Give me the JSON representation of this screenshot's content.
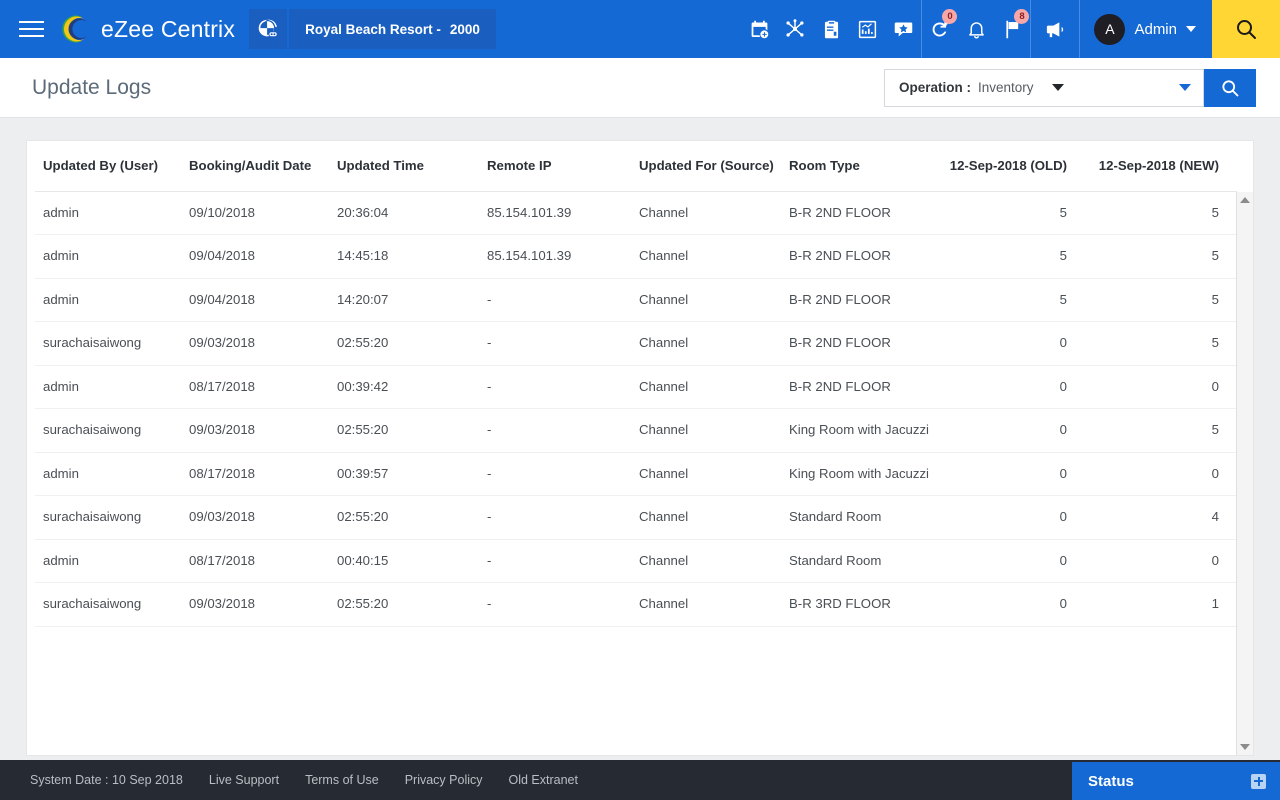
{
  "topbar": {
    "menu_icon": "hamburger-icon",
    "brand": "eZee Centrix",
    "property_name": "Royal Beach Resort -",
    "property_id": "2000",
    "tools": [
      {
        "icon": "calendar-add-icon",
        "name": "calendar"
      },
      {
        "icon": "channel-network-icon",
        "name": "channels"
      },
      {
        "icon": "clipboard-icon",
        "name": "reports"
      },
      {
        "icon": "chart-icon",
        "name": "analytics"
      },
      {
        "icon": "review-star-icon",
        "name": "reviews"
      }
    ],
    "alerts": [
      {
        "icon": "history-revert-icon",
        "badge": "0"
      },
      {
        "icon": "bell-icon",
        "badge": ""
      },
      {
        "icon": "flag-icon",
        "badge": "8"
      }
    ],
    "announce_icon": "megaphone-icon",
    "user_initial": "A",
    "user_name": "Admin",
    "search_icon": "search-icon",
    "colors": {
      "nav_blue": "#1569d4",
      "chip_blue": "#1a5fc0",
      "search_yellow": "#ffd633",
      "badge_pink": "#f7a7a7"
    }
  },
  "page": {
    "title": "Update Logs",
    "filter_label": "Operation :",
    "filter_value": "Inventory",
    "search_button_icon": "search-icon"
  },
  "table": {
    "columns": [
      {
        "label": "Updated By (User)",
        "align": "left"
      },
      {
        "label": "Booking/Audit Date",
        "align": "left"
      },
      {
        "label": "Updated Time",
        "align": "left"
      },
      {
        "label": "Remote IP",
        "align": "left"
      },
      {
        "label": "Updated For (Source)",
        "align": "left"
      },
      {
        "label": "Room Type",
        "align": "left"
      },
      {
        "label": "12-Sep-2018 (OLD)",
        "align": "right"
      },
      {
        "label": "12-Sep-2018 (NEW)",
        "align": "right"
      }
    ],
    "rows": [
      [
        "admin",
        "09/10/2018",
        "20:36:04",
        "85.154.101.39",
        "Channel",
        "B-R 2ND FLOOR",
        "5",
        "5"
      ],
      [
        "admin",
        "09/04/2018",
        "14:45:18",
        "85.154.101.39",
        "Channel",
        "B-R 2ND FLOOR",
        "5",
        "5"
      ],
      [
        "admin",
        "09/04/2018",
        "14:20:07",
        "-",
        "Channel",
        "B-R 2ND FLOOR",
        "5",
        "5"
      ],
      [
        "surachaisaiwong",
        "09/03/2018",
        "02:55:20",
        "-",
        "Channel",
        "B-R 2ND FLOOR",
        "0",
        "5"
      ],
      [
        "admin",
        "08/17/2018",
        "00:39:42",
        "-",
        "Channel",
        "B-R 2ND FLOOR",
        "0",
        "0"
      ],
      [
        "surachaisaiwong",
        "09/03/2018",
        "02:55:20",
        "-",
        "Channel",
        "King Room with Jacuzzi",
        "0",
        "5"
      ],
      [
        "admin",
        "08/17/2018",
        "00:39:57",
        "-",
        "Channel",
        "King Room with Jacuzzi",
        "0",
        "0"
      ],
      [
        "surachaisaiwong",
        "09/03/2018",
        "02:55:20",
        "-",
        "Channel",
        "Standard Room",
        "0",
        "4"
      ],
      [
        "admin",
        "08/17/2018",
        "00:40:15",
        "-",
        "Channel",
        "Standard Room",
        "0",
        "0"
      ],
      [
        "surachaisaiwong",
        "09/03/2018",
        "02:55:20",
        "-",
        "Channel",
        "B-R 3RD FLOOR",
        "0",
        "1"
      ]
    ]
  },
  "footer": {
    "system_date": "System Date : 10 Sep 2018",
    "links": [
      "Live Support",
      "Terms of Use",
      "Privacy Policy",
      "Old Extranet"
    ],
    "status_title": "Status",
    "status_icon": "expand-plus-icon"
  }
}
